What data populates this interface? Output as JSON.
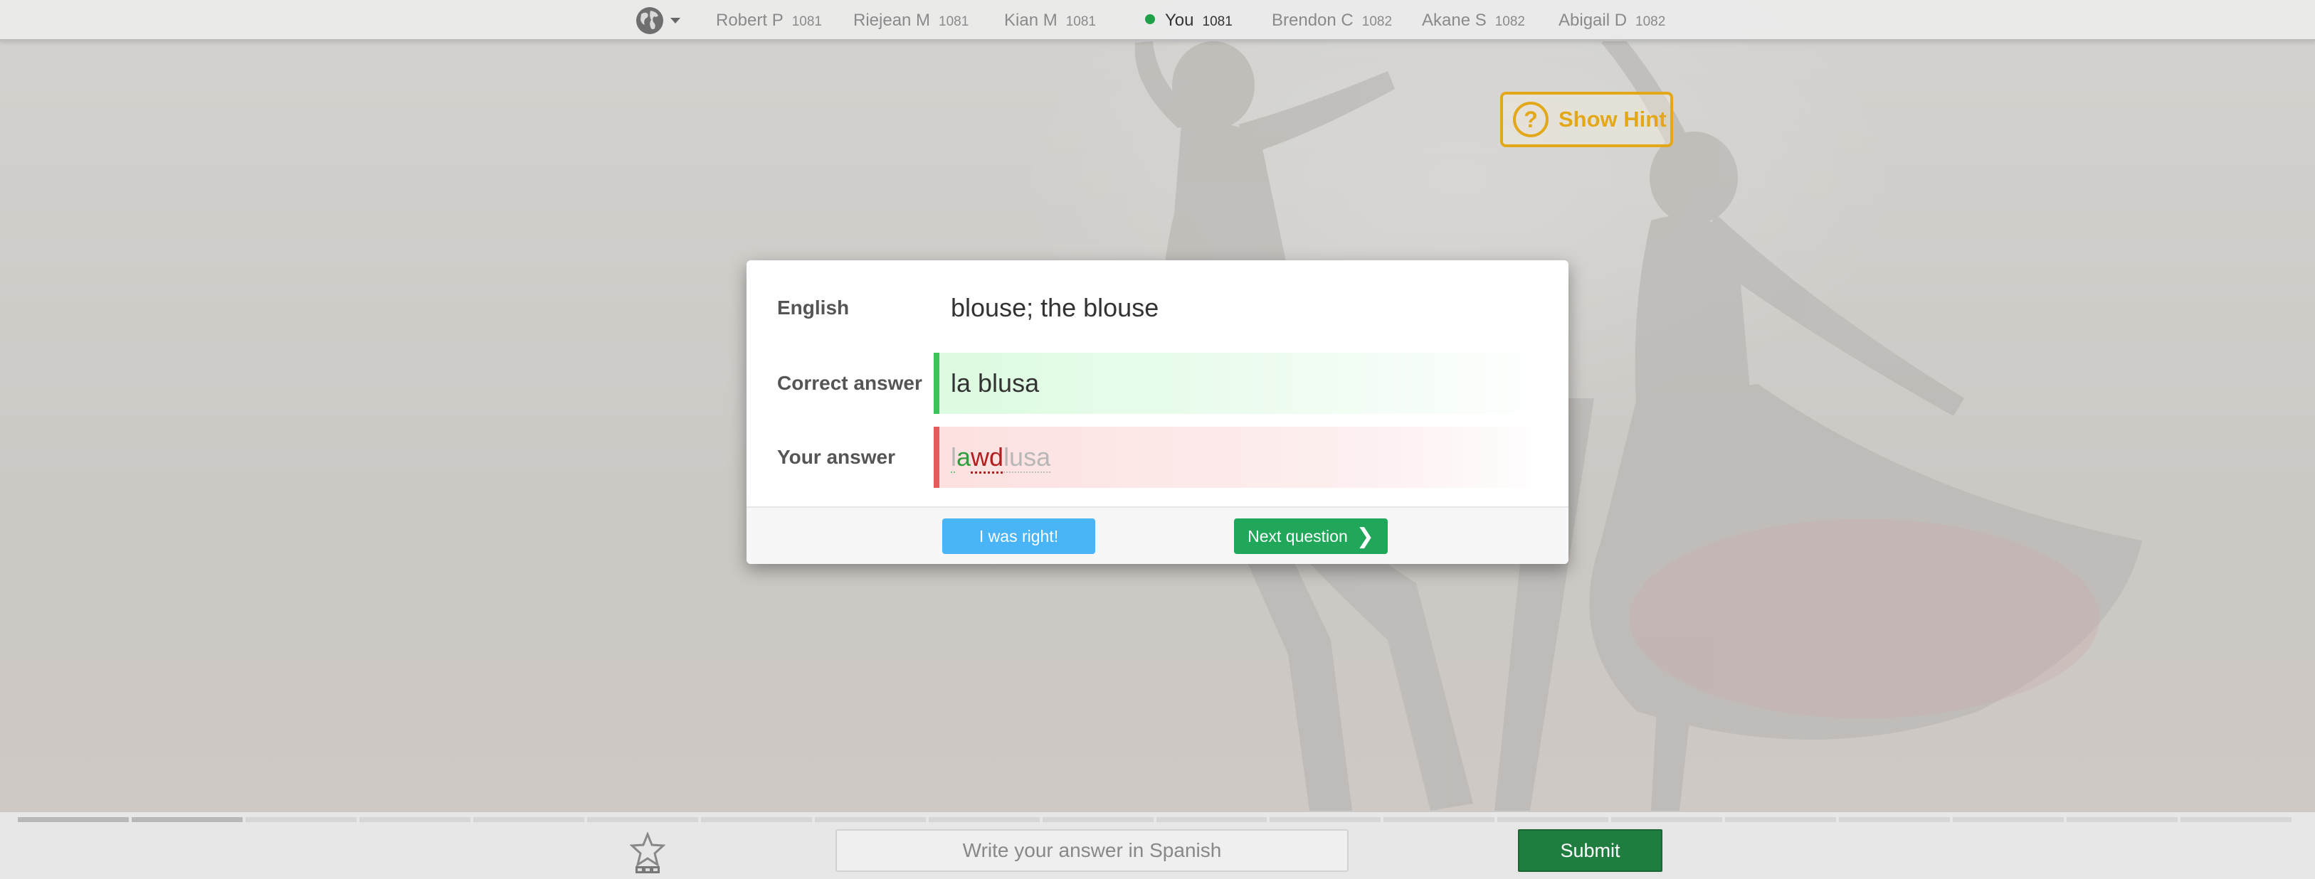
{
  "leaderboard": {
    "language_icon": "globe-icon",
    "players": [
      {
        "name": "Robert P",
        "score": "1081",
        "is_you": false
      },
      {
        "name": "Riejean M",
        "score": "1081",
        "is_you": false
      },
      {
        "name": "Kian M",
        "score": "1081",
        "is_you": false
      },
      {
        "name": "You",
        "score": "1081",
        "is_you": true
      },
      {
        "name": "Brendon C",
        "score": "1082",
        "is_you": false
      },
      {
        "name": "Akane S",
        "score": "1082",
        "is_you": false
      },
      {
        "name": "Abigail D",
        "score": "1082",
        "is_you": false
      }
    ]
  },
  "hint": {
    "icon": "question-circle-icon",
    "label": "Show Hint",
    "color": "#e3a81a"
  },
  "result": {
    "english_label": "English",
    "english_value": "blouse; the blouse",
    "correct_label": "Correct answer",
    "correct_value": "la blusa",
    "your_label": "Your answer",
    "your_answer_full": "lawdlusa",
    "your_answer_parts": [
      {
        "text": "l",
        "status": "ok"
      },
      {
        "text": "a",
        "status": "inserted"
      },
      {
        "text": "wd",
        "status": "wrong"
      },
      {
        "text": "lusa",
        "status": "ok"
      }
    ],
    "correct_color": "#3cc45a",
    "wrong_color": "#e55b5b",
    "i_was_right_label": "I was right!",
    "next_question_label": "Next question"
  },
  "progress": {
    "total_segments": 20,
    "answered": 2,
    "wrong_segments": [
      1
    ],
    "wrong_color": "#e07070"
  },
  "answer_bar": {
    "placeholder": "Write your answer in Spanish",
    "submit_label": "Submit",
    "badge_icon": "star-badge-icon"
  },
  "colors": {
    "primary_green": "#20a75a",
    "info_blue": "#49b4f6",
    "submit_green": "#1f7d3f"
  }
}
